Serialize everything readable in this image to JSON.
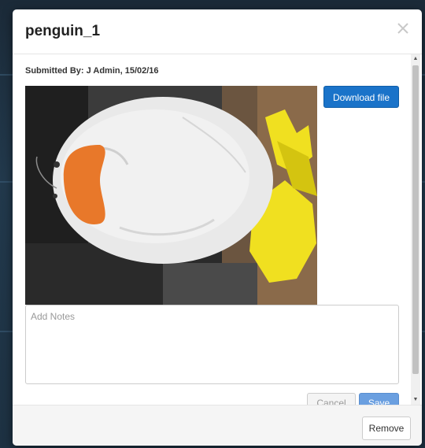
{
  "modal": {
    "title": "penguin_1",
    "submitted_by": "Submitted By: J Admin, 15/02/16",
    "download_label": "Download file",
    "notes": {
      "placeholder": "Add Notes",
      "value": ""
    },
    "cancel_label": "Cancel",
    "save_label": "Save",
    "remove_label": "Remove"
  },
  "icons": {
    "close": "close-icon",
    "scroll_up": "chevron-up-icon",
    "scroll_down": "chevron-down-icon"
  },
  "colors": {
    "primary": "#1a73c9",
    "save_disabled": "#6a9fe0",
    "footer_bg": "#f5f5f5"
  }
}
